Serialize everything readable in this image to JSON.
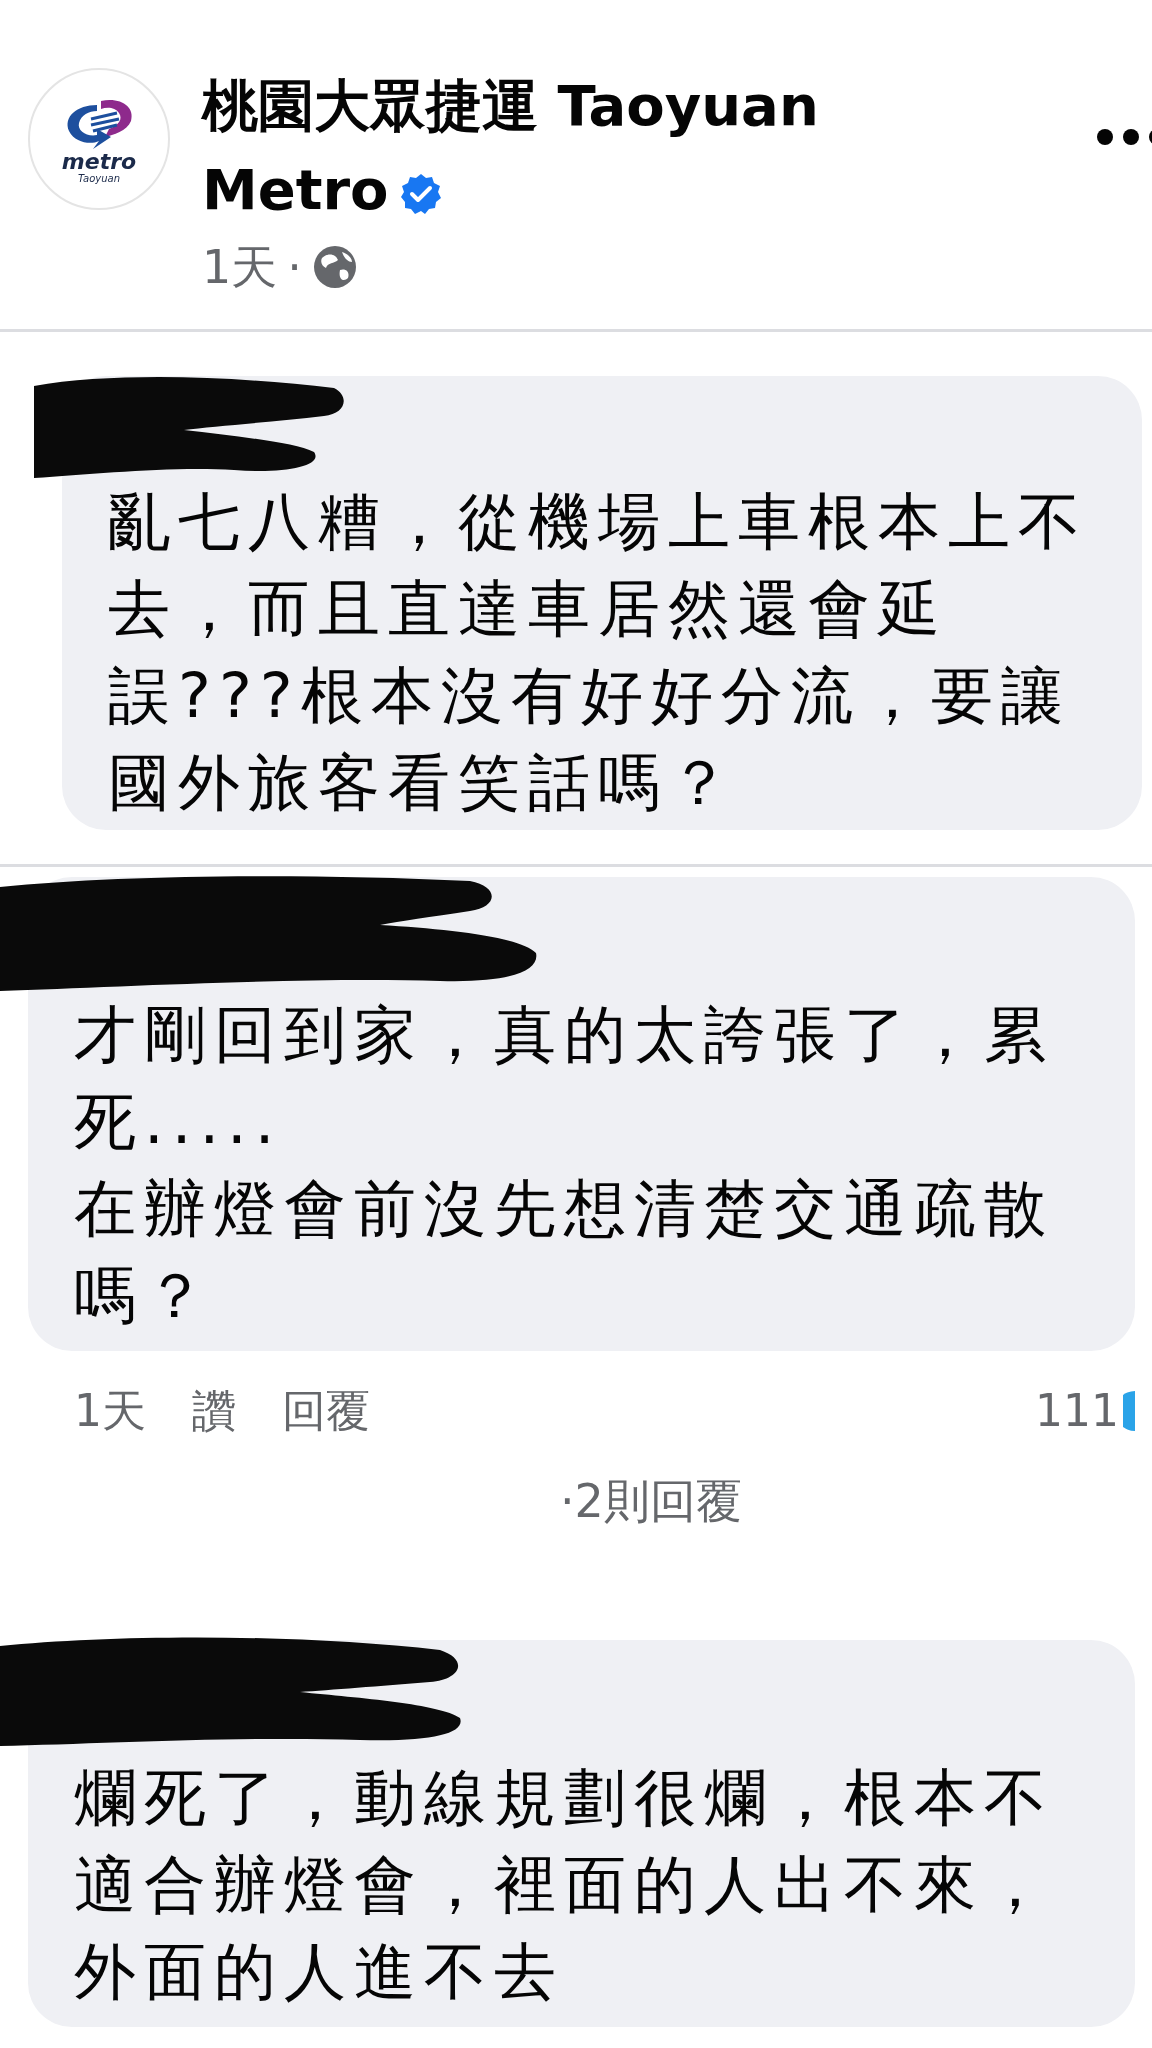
{
  "post": {
    "page_name": "桃園大眾捷運 Taoyuan Metro",
    "verified": true,
    "time": "1天",
    "separator": "·",
    "logo_text": "metro",
    "logo_subtext": "Taoyuan"
  },
  "comments": [
    {
      "redacted": true,
      "text": "亂七八糟，從機場上車根本上不去，而且直達車居然還會延誤???根本沒有好好分流，要讓國外旅客看笑話嗎？"
    },
    {
      "redacted": true,
      "text": "才剛回到家，真的太誇張了，累死.....\n在辦燈會前沒先想清楚交通疏散嗎？",
      "actions": {
        "time": "1天",
        "like": "讚",
        "reply": "回覆",
        "reaction_count": "111"
      },
      "replies_summary": "·2則回覆"
    },
    {
      "redacted": true,
      "text": "爛死了，動線規劃很爛，根本不適合辦燈會，裡面的人出不來，外面的人進不去"
    }
  ]
}
